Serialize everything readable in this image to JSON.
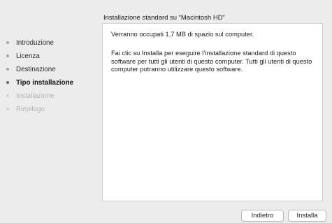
{
  "header": {
    "title": "Installazione standard su “Macintosh HD”"
  },
  "sidebar": {
    "steps": [
      {
        "label": "Introduzione",
        "state": "done"
      },
      {
        "label": "Licenza",
        "state": "done"
      },
      {
        "label": "Destinazione",
        "state": "done"
      },
      {
        "label": "Tipo installazione",
        "state": "current"
      },
      {
        "label": "Installazione",
        "state": "future"
      },
      {
        "label": "Riepilogo",
        "state": "future"
      }
    ]
  },
  "main": {
    "space_text": "Verranno occupati 1,7 MB di spazio sul computer.",
    "description": "Fai clic su Installa per eseguire l’installazione standard di questo software per tutti gli utenti di questo computer. Tutti gli utenti di questo computer potranno utilizzare questo software."
  },
  "footer": {
    "back_label": "Indietro",
    "install_label": "Installa"
  }
}
